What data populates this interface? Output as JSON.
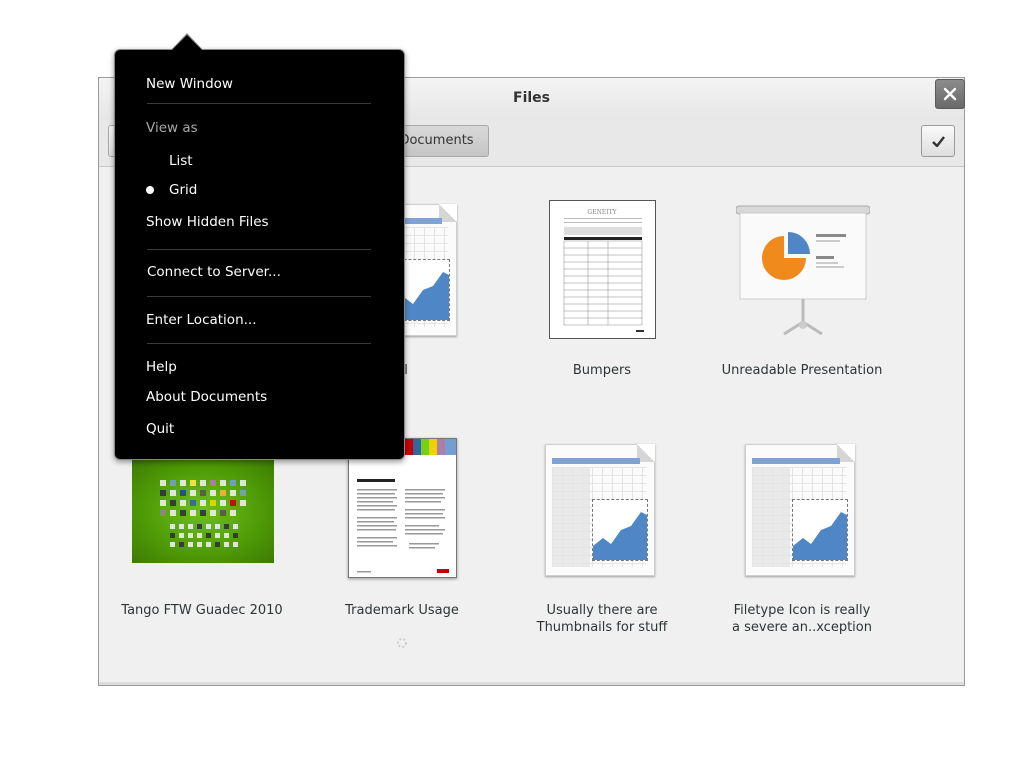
{
  "window": {
    "title": "Files",
    "breadcrumb_label": "Documents"
  },
  "menu": {
    "new_window": "New Window",
    "view_as": "View as",
    "list": "List",
    "grid": "Grid",
    "selected_view": "Grid",
    "show_hidden": "Show Hidden Files",
    "connect": "Connect to Server...",
    "enter_location": "Enter Location...",
    "help": "Help",
    "about": "About Documents",
    "quit": "Quit"
  },
  "items": [
    {
      "label": "for April",
      "thumb": "spreadsheet"
    },
    {
      "label": "Bumpers",
      "thumb": "document-table"
    },
    {
      "label": "Unreadable Presentation",
      "thumb": "presentation"
    },
    {
      "label": "Tango FTW Guadec 2010",
      "thumb": "image-green-icons"
    },
    {
      "label": "Trademark Usage",
      "thumb": "document-guide"
    },
    {
      "label": "Usually there are Thumbnails for stuff",
      "label_lines": [
        "Usually there are",
        "Thumbnails for stuff"
      ],
      "thumb": "spreadsheet"
    },
    {
      "label": "Filetype Icon is really a severe an..xception",
      "label_lines": [
        "Filetype Icon is really",
        "a severe an..xception"
      ],
      "thumb": "spreadsheet"
    }
  ],
  "icons": {
    "close": "close-icon",
    "select": "checkmark-icon",
    "spinner": "loading-spinner-icon"
  },
  "colors": {
    "popover_bg": "#000000",
    "sheet_header": "#7fa2d8",
    "chart_fill": "#4f86c6",
    "tango_bg": "#4e9a06"
  }
}
